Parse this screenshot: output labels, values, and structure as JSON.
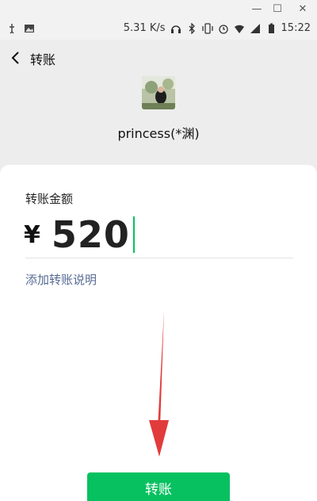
{
  "status_bar": {
    "network_speed": "5.31 K/s",
    "time": "15:22"
  },
  "nav": {
    "title": "转账"
  },
  "recipient": {
    "name": "princess(*渊)"
  },
  "form": {
    "amount_label": "转账金额",
    "currency_symbol": "¥",
    "amount_value": "520",
    "add_note_link": "添加转账说明"
  },
  "actions": {
    "transfer_button": "转账"
  },
  "colors": {
    "primary_green": "#07c160",
    "link_blue": "#576b95",
    "annotation_arrow": "#e23b3b"
  },
  "icons": {
    "window_controls": [
      "minimize-icon",
      "maximize-icon",
      "close-icon"
    ],
    "status_left": [
      "usb-icon",
      "image-icon"
    ],
    "status_right": [
      "headphones-icon",
      "bluetooth-icon",
      "vibrate-icon",
      "alarm-icon",
      "wifi-icon",
      "signal-icon",
      "battery-icon"
    ],
    "nav": "back-arrow-icon"
  }
}
